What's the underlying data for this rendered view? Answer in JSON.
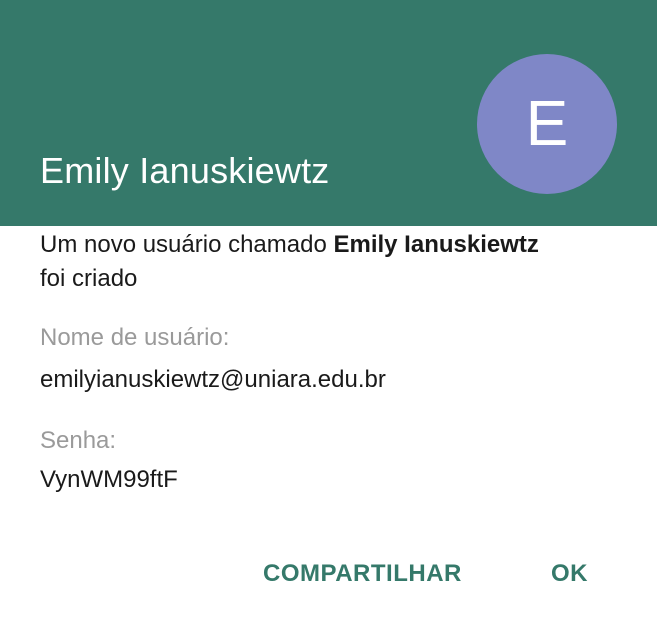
{
  "header": {
    "title": "Emily Ianuskiewtz",
    "avatar_letter": "E",
    "background_color": "#35796a",
    "avatar_color": "#7f87c7"
  },
  "message": {
    "prefix": "Um novo usuário chamado ",
    "name": "Emily Ianuskiewtz",
    "suffix": "foi criado"
  },
  "fields": {
    "username_label": "Nome de usuário:",
    "username_value": "emilyianuskiewtz@uniara.edu.br",
    "password_label": "Senha:",
    "password_value": "VynWM99ftF"
  },
  "actions": {
    "share_label": "COMPARTILHAR",
    "ok_label": "OK",
    "accent_color": "#35796a"
  }
}
